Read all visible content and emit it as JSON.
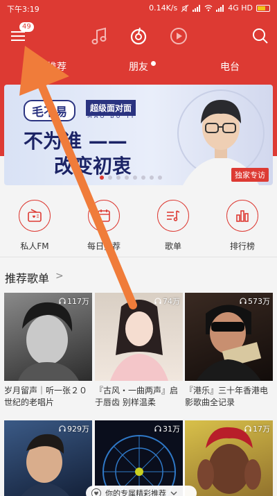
{
  "status": {
    "time": "下午3:19",
    "speed": "0.14K/s",
    "network": "4G HD"
  },
  "header": {
    "badge_count": "49"
  },
  "tabs": [
    "个性推荐",
    "朋友",
    "电台"
  ],
  "banner": {
    "tag1": "毛不易",
    "tag2": "超级面对面",
    "tag3": "MAO BU YI",
    "line1": "不为谁 ——",
    "line2": "改变初衷",
    "exclusive": "独家专访"
  },
  "quick": [
    {
      "label": "私人FM",
      "icon": "radio-icon"
    },
    {
      "label": "每日推荐",
      "icon": "calendar-icon"
    },
    {
      "label": "歌单",
      "icon": "playlist-icon"
    },
    {
      "label": "排行榜",
      "icon": "chart-icon"
    }
  ],
  "section": {
    "title": "推荐歌单"
  },
  "playlists": [
    {
      "count": "117万",
      "title": "岁月留声｜听一张２０世纪的老唱片"
    },
    {
      "count": "74万",
      "title": "『古风・一曲两声』启于唇齿 别样温柔"
    },
    {
      "count": "573万",
      "title": "『港乐』三十年香港电影歌曲全记录"
    },
    {
      "count": "929万",
      "title": ""
    },
    {
      "count": "31万",
      "title": ""
    },
    {
      "count": "17万",
      "title": ""
    }
  ],
  "bottom_pill": "你的专属精彩推荐",
  "colors": {
    "brand_red": "#dd3a33",
    "arrow": "#f07c3a"
  }
}
